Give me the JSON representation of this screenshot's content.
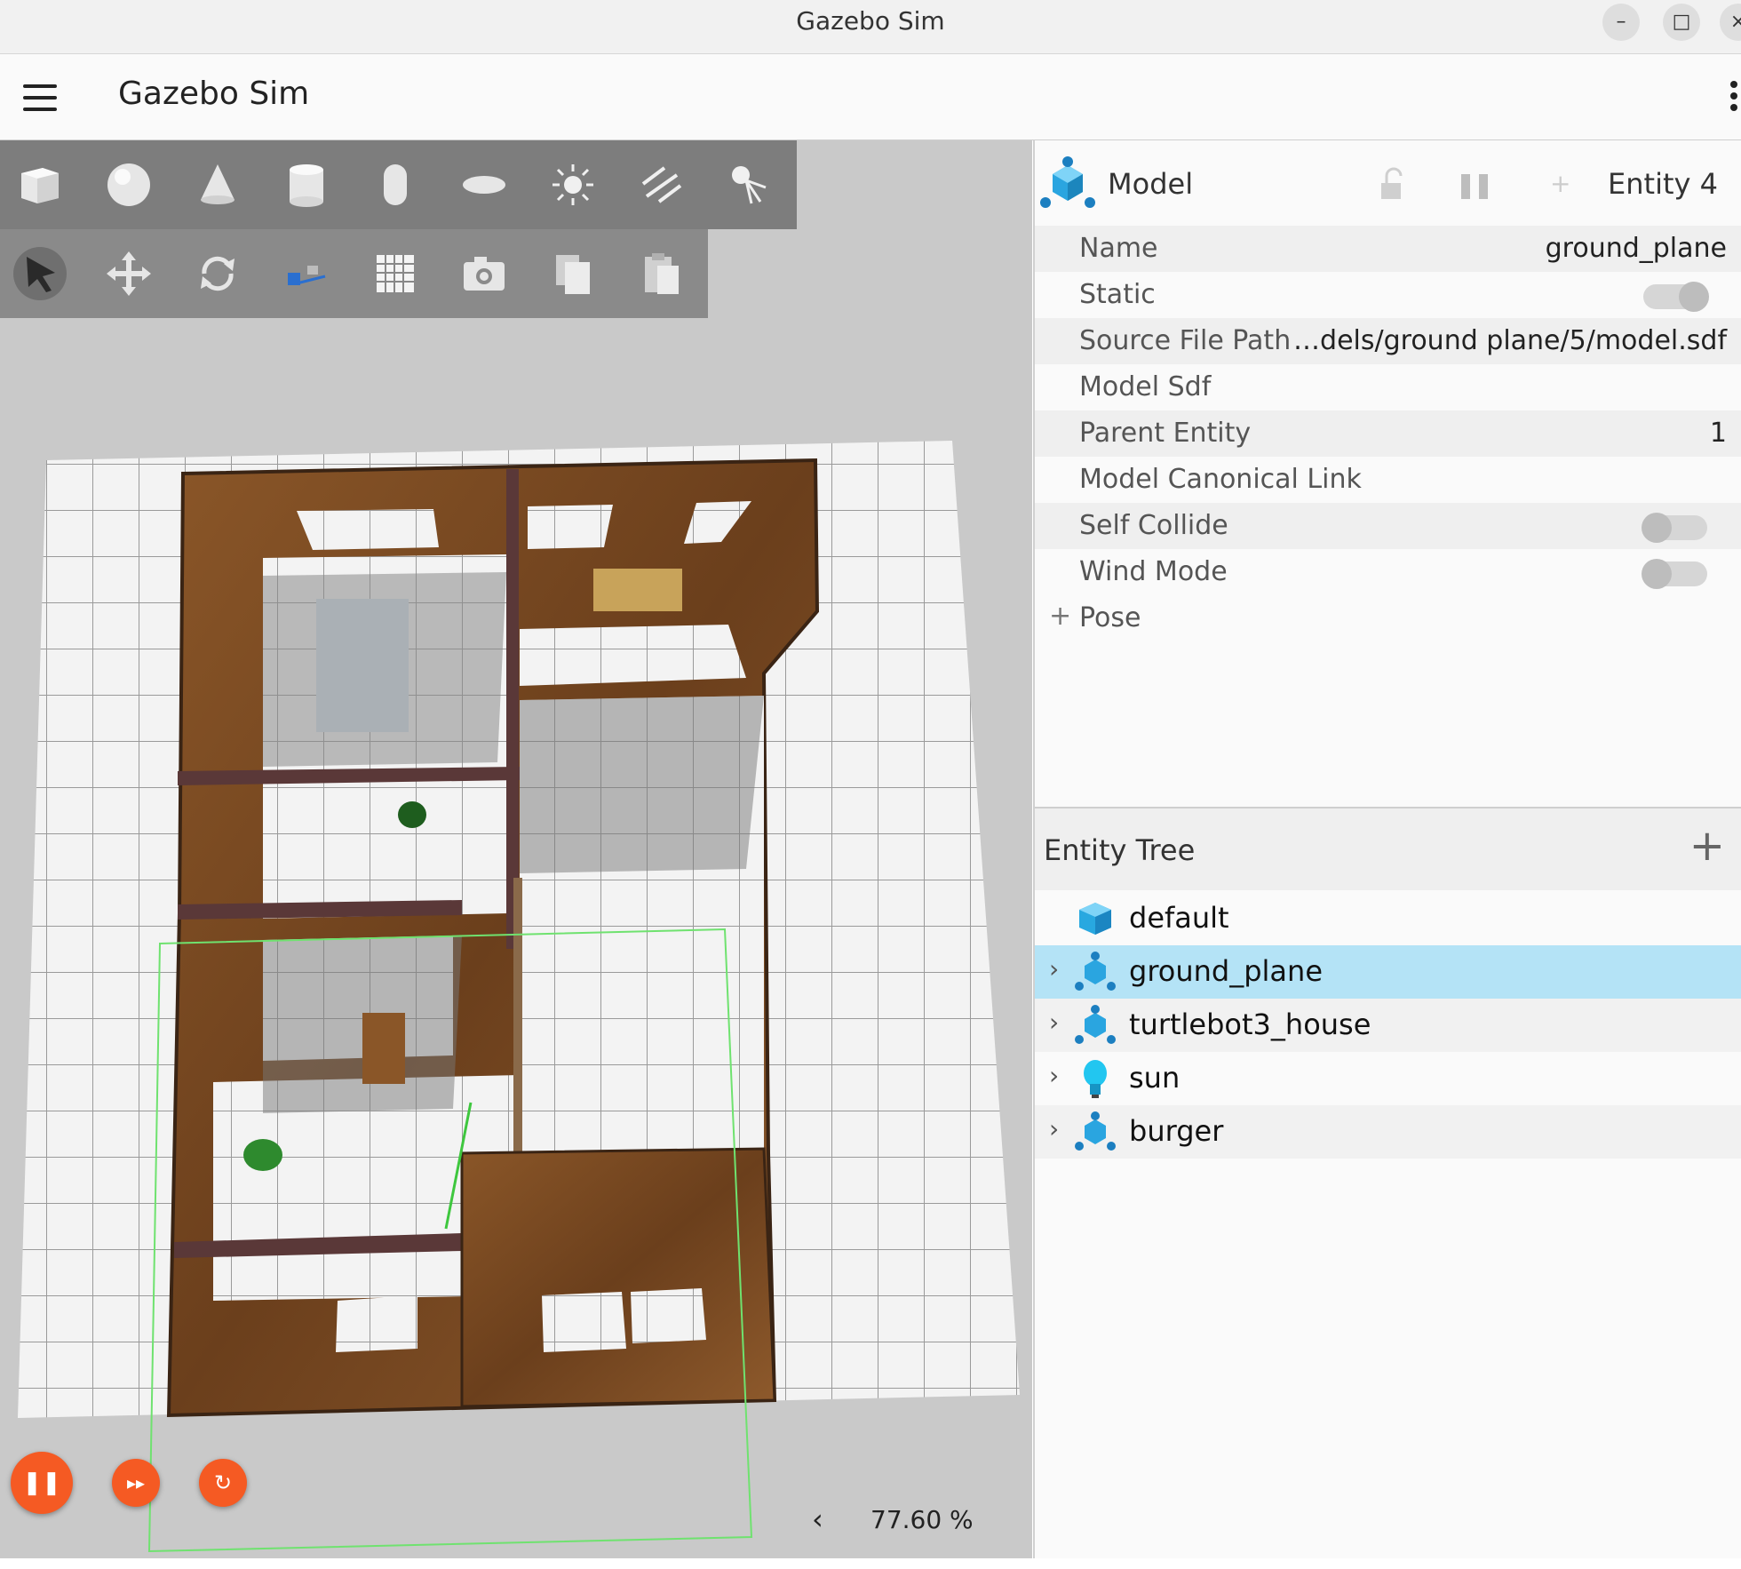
{
  "window": {
    "title": "Gazebo Sim",
    "minimize": "–",
    "maximize": "□",
    "close": "×"
  },
  "appbar": {
    "title": "Gazebo Sim"
  },
  "toolbar": {
    "shapes": [
      "box-icon",
      "sphere-icon",
      "cone-icon",
      "cylinder-icon",
      "capsule-icon",
      "ellipsoid-icon",
      "point-light-icon",
      "directional-light-icon",
      "spot-light-icon"
    ],
    "transform": [
      "select-icon",
      "translate-icon",
      "rotate-icon",
      "transform-control-icon",
      "grid-snap-icon",
      "screenshot-icon",
      "copy-icon",
      "paste-icon"
    ]
  },
  "playback": {
    "pause_icon": "❚❚",
    "step_icon": "▸▸",
    "reset_icon": "↻",
    "collapse_icon": "‹",
    "rtf": "77.60 %"
  },
  "component_inspector": {
    "type": "Model",
    "entity": "Entity 4",
    "rows": [
      {
        "key": "Name",
        "value": "ground_plane"
      },
      {
        "key": "Static",
        "toggle": true
      },
      {
        "key": "Source File Path",
        "value": "…dels/ground plane/5/model.sdf"
      },
      {
        "key": "Model Sdf",
        "value": ""
      },
      {
        "key": "Parent Entity",
        "value": "1"
      },
      {
        "key": "Model Canonical Link",
        "value": ""
      },
      {
        "key": "Self Collide",
        "toggle": false
      },
      {
        "key": "Wind Mode",
        "toggle": false
      }
    ],
    "pose_label": "Pose",
    "pose_expand": "+"
  },
  "entity_tree": {
    "title": "Entity Tree",
    "add": "+",
    "items": [
      {
        "name": "default",
        "icon": "world-cube-icon"
      },
      {
        "name": "ground_plane",
        "icon": "model-icon"
      },
      {
        "name": "turtlebot3_house",
        "icon": "model-icon"
      },
      {
        "name": "sun",
        "icon": "light-bulb-icon"
      },
      {
        "name": "burger",
        "icon": "model-icon"
      }
    ],
    "chevron": "›"
  },
  "colors": {
    "accent": "#f55a23",
    "selected_row": "#b4e3f6",
    "model_icon": "#2aa5e0"
  }
}
